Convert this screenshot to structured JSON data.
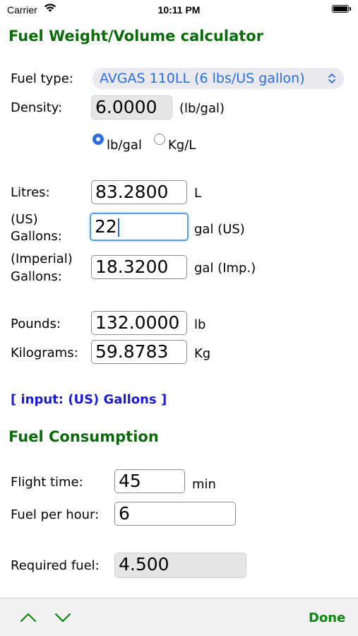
{
  "status_bar": {
    "carrier": "Carrier",
    "time": "10:11 PM"
  },
  "weight_volume": {
    "title": "Fuel Weight/Volume calculator",
    "fuel_type_label": "Fuel type:",
    "fuel_type_value": "AVGAS 110LL (6 lbs/US gallon)",
    "density_label": "Density:",
    "density_value": "6.0000",
    "density_unit": "(lb/gal)",
    "unit_options": [
      {
        "label": "lb/gal",
        "selected": true
      },
      {
        "label": "Kg/L",
        "selected": false
      }
    ],
    "litres_label": "Litres:",
    "litres_value": "83.2800",
    "litres_unit": "L",
    "us_gallons_label_1": "(US)",
    "us_gallons_label_2": "Gallons:",
    "us_gallons_value": "22",
    "us_gallons_unit": "gal (US)",
    "imp_gallons_label_1": "(Imperial)",
    "imp_gallons_label_2": "Gallons:",
    "imp_gallons_value": "18.3200",
    "imp_gallons_unit": "gal (Imp.)",
    "pounds_label": "Pounds:",
    "pounds_value": "132.0000",
    "pounds_unit": "lb",
    "kilograms_label": "Kilograms:",
    "kilograms_value": "59.8783",
    "kilograms_unit": "Kg",
    "input_note": "[ input: (US) Gallons ]"
  },
  "consumption": {
    "title": "Fuel Consumption",
    "flight_time_label": "Flight time:",
    "flight_time_value": "45",
    "flight_time_unit": "min",
    "fuel_per_hour_label": "Fuel per hour:",
    "fuel_per_hour_value": "6",
    "required_fuel_label": "Required fuel:",
    "required_fuel_value": "4.500"
  },
  "toolbar": {
    "done_label": "Done",
    "prev_icon": "chevron-up-icon",
    "next_icon": "chevron-down-icon"
  },
  "colors": {
    "heading_green": "#0a6b0a",
    "accent_blue": "#2a6fdb",
    "note_blue": "#1a1ad6",
    "done_green": "#0a8a0a"
  }
}
